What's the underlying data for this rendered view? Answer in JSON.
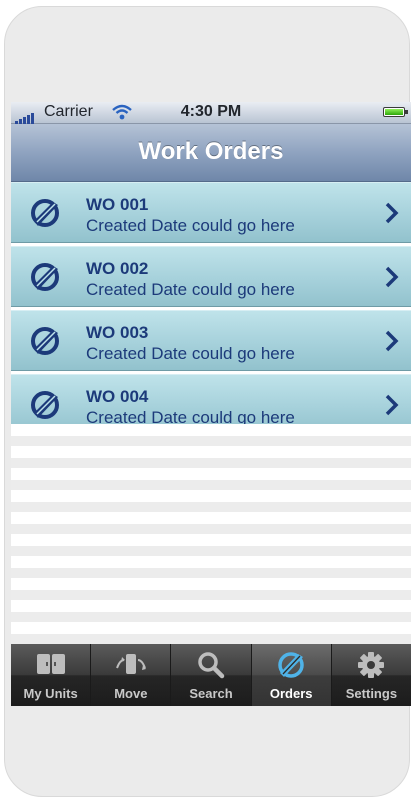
{
  "status_bar": {
    "carrier": "Carrier",
    "time": "4:30 PM"
  },
  "nav": {
    "title": "Work Orders"
  },
  "work_orders": [
    {
      "title": "WO 001",
      "subtitle": "Created Date could go here"
    },
    {
      "title": "WO 002",
      "subtitle": "Created Date could go here"
    },
    {
      "title": "WO 003",
      "subtitle": "Created Date could go here"
    },
    {
      "title": "WO 004",
      "subtitle": "Created Date could go here"
    }
  ],
  "tabs": [
    {
      "label": "My Units",
      "icon": "units-icon"
    },
    {
      "label": "Move",
      "icon": "move-icon"
    },
    {
      "label": "Search",
      "icon": "search-icon"
    },
    {
      "label": "Orders",
      "icon": "orders-icon",
      "active": true
    },
    {
      "label": "Settings",
      "icon": "gear-icon"
    }
  ],
  "colors": {
    "row_text": "#1c3a7a",
    "row_bg": "#a6d1db",
    "nav_bg": "#8fa3c0",
    "tab_active_icon": "#4fb3e8"
  }
}
